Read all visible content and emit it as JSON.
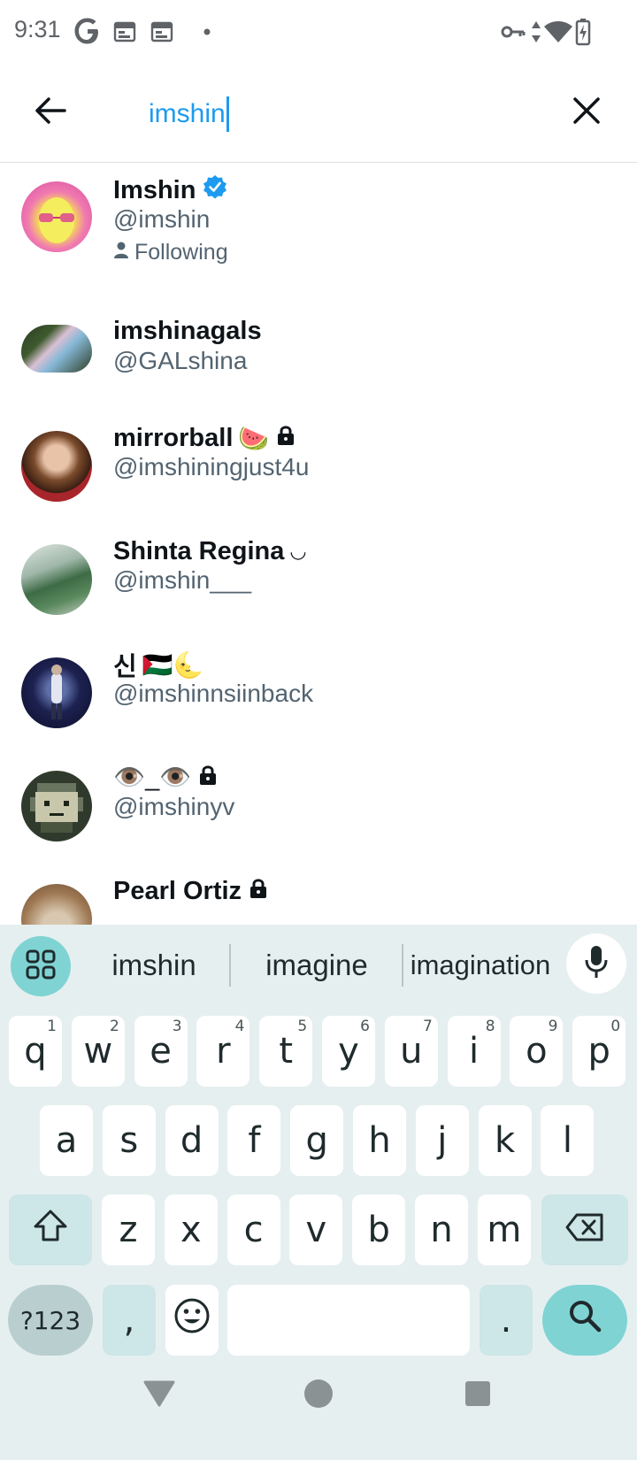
{
  "status_bar": {
    "time": "9:31",
    "left_icons": [
      "google-icon",
      "calendar-icon",
      "calendar-icon",
      "dot-icon"
    ],
    "right_icons": [
      "vpn-key-icon",
      "data-arrows-icon",
      "wifi-icon",
      "battery-charging-icon"
    ]
  },
  "search": {
    "query": "imshin",
    "back_icon": "arrow-left-icon",
    "clear_icon": "close-icon"
  },
  "results": [
    {
      "name": "Imshin",
      "handle": "@imshin",
      "verified": true,
      "following_label": "Following",
      "protected": false,
      "emoji": ""
    },
    {
      "name": "imshinagals",
      "handle": "@GALshina",
      "verified": false,
      "protected": false,
      "emoji": ""
    },
    {
      "name": "mirrorball",
      "handle": "@imshiningjust4u",
      "verified": false,
      "protected": true,
      "emoji": "🍉"
    },
    {
      "name": "Shinta Regina",
      "handle": "@imshin___",
      "verified": false,
      "protected": false,
      "emoji": "◡"
    },
    {
      "name": "신",
      "handle": "@imshinnsiinback",
      "verified": false,
      "protected": false,
      "emoji": "🇵🇸🌜"
    },
    {
      "name": "👁️_👁️",
      "handle": "@imshinyv",
      "verified": false,
      "protected": true,
      "emoji": ""
    },
    {
      "name": "Pearl Ortiz",
      "handle": "",
      "verified": false,
      "protected": true,
      "emoji": ""
    }
  ],
  "keyboard": {
    "suggestions": [
      "imshin",
      "imagine",
      "imagination"
    ],
    "row1": [
      {
        "k": "q",
        "h": "1"
      },
      {
        "k": "w",
        "h": "2"
      },
      {
        "k": "e",
        "h": "3"
      },
      {
        "k": "r",
        "h": "4"
      },
      {
        "k": "t",
        "h": "5"
      },
      {
        "k": "y",
        "h": "6"
      },
      {
        "k": "u",
        "h": "7"
      },
      {
        "k": "i",
        "h": "8"
      },
      {
        "k": "o",
        "h": "9"
      },
      {
        "k": "p",
        "h": "0"
      }
    ],
    "row2": [
      "a",
      "s",
      "d",
      "f",
      "g",
      "h",
      "j",
      "k",
      "l"
    ],
    "row3": [
      "z",
      "x",
      "c",
      "v",
      "b",
      "n",
      "m"
    ],
    "symbols_label": "?123",
    "comma_label": ",",
    "period_label": ".",
    "icons": [
      "apps-grid-icon",
      "microphone-icon",
      "shift-icon",
      "backspace-icon",
      "emoji-icon",
      "search-icon"
    ]
  },
  "nav": {
    "icons": [
      "back-triangle-icon",
      "home-circle-icon",
      "recents-square-icon"
    ]
  },
  "colors": {
    "accent": "#1d9bf0",
    "text": "#0f1419",
    "secondary": "#536471",
    "keyboard_bg": "#e6eff0",
    "action_key": "#7fd3d3"
  }
}
